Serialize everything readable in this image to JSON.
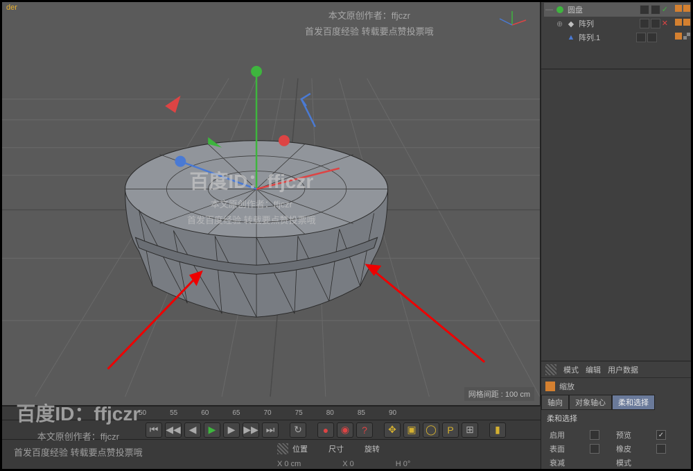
{
  "viewport": {
    "title": "der",
    "grid_spacing_label": "网格间距 : 100 cm"
  },
  "ruler": {
    "ticks": [
      "50",
      "55",
      "60",
      "65",
      "70",
      "75",
      "80",
      "85",
      "90"
    ]
  },
  "coords": {
    "pos_label": "位置",
    "size_label": "尺寸",
    "rot_label": "旋转",
    "x_pos": "X 0 cm",
    "x_size": "X 0",
    "h_rot": "H 0°"
  },
  "tree": {
    "items": [
      {
        "label": "圆盘",
        "icon": "disc",
        "sel": true,
        "vis": [
          "grey",
          "grey",
          "check"
        ],
        "extra": [
          "orange",
          "orange"
        ]
      },
      {
        "label": "阵列",
        "icon": "array",
        "sel": false,
        "vis": [
          "grey",
          "grey",
          "x"
        ],
        "extra": [
          "orange",
          "orange"
        ]
      },
      {
        "label": "阵列.1",
        "icon": "array",
        "sel": false,
        "vis": [
          "grey",
          "grey",
          ""
        ],
        "extra": [
          "orange",
          "checker"
        ]
      }
    ]
  },
  "attr": {
    "header": {
      "mode": "模式",
      "edit": "编辑",
      "userdata": "用户数据"
    },
    "title": "缩放",
    "tabs": [
      "轴向",
      "对象轴心",
      "柔和选择"
    ],
    "active_tab": 2,
    "section": "柔和选择",
    "props": {
      "enable": "启用",
      "preview": "预览",
      "surface": "表面",
      "rubber": "橡皮",
      "falloff": "衰减",
      "mode": "模式"
    }
  },
  "watermarks": {
    "main": "百度ID：ffjczr",
    "line1": "本文原创作者：ffjczr",
    "line2": "首发百度经验 转载要点赞投票哦"
  }
}
